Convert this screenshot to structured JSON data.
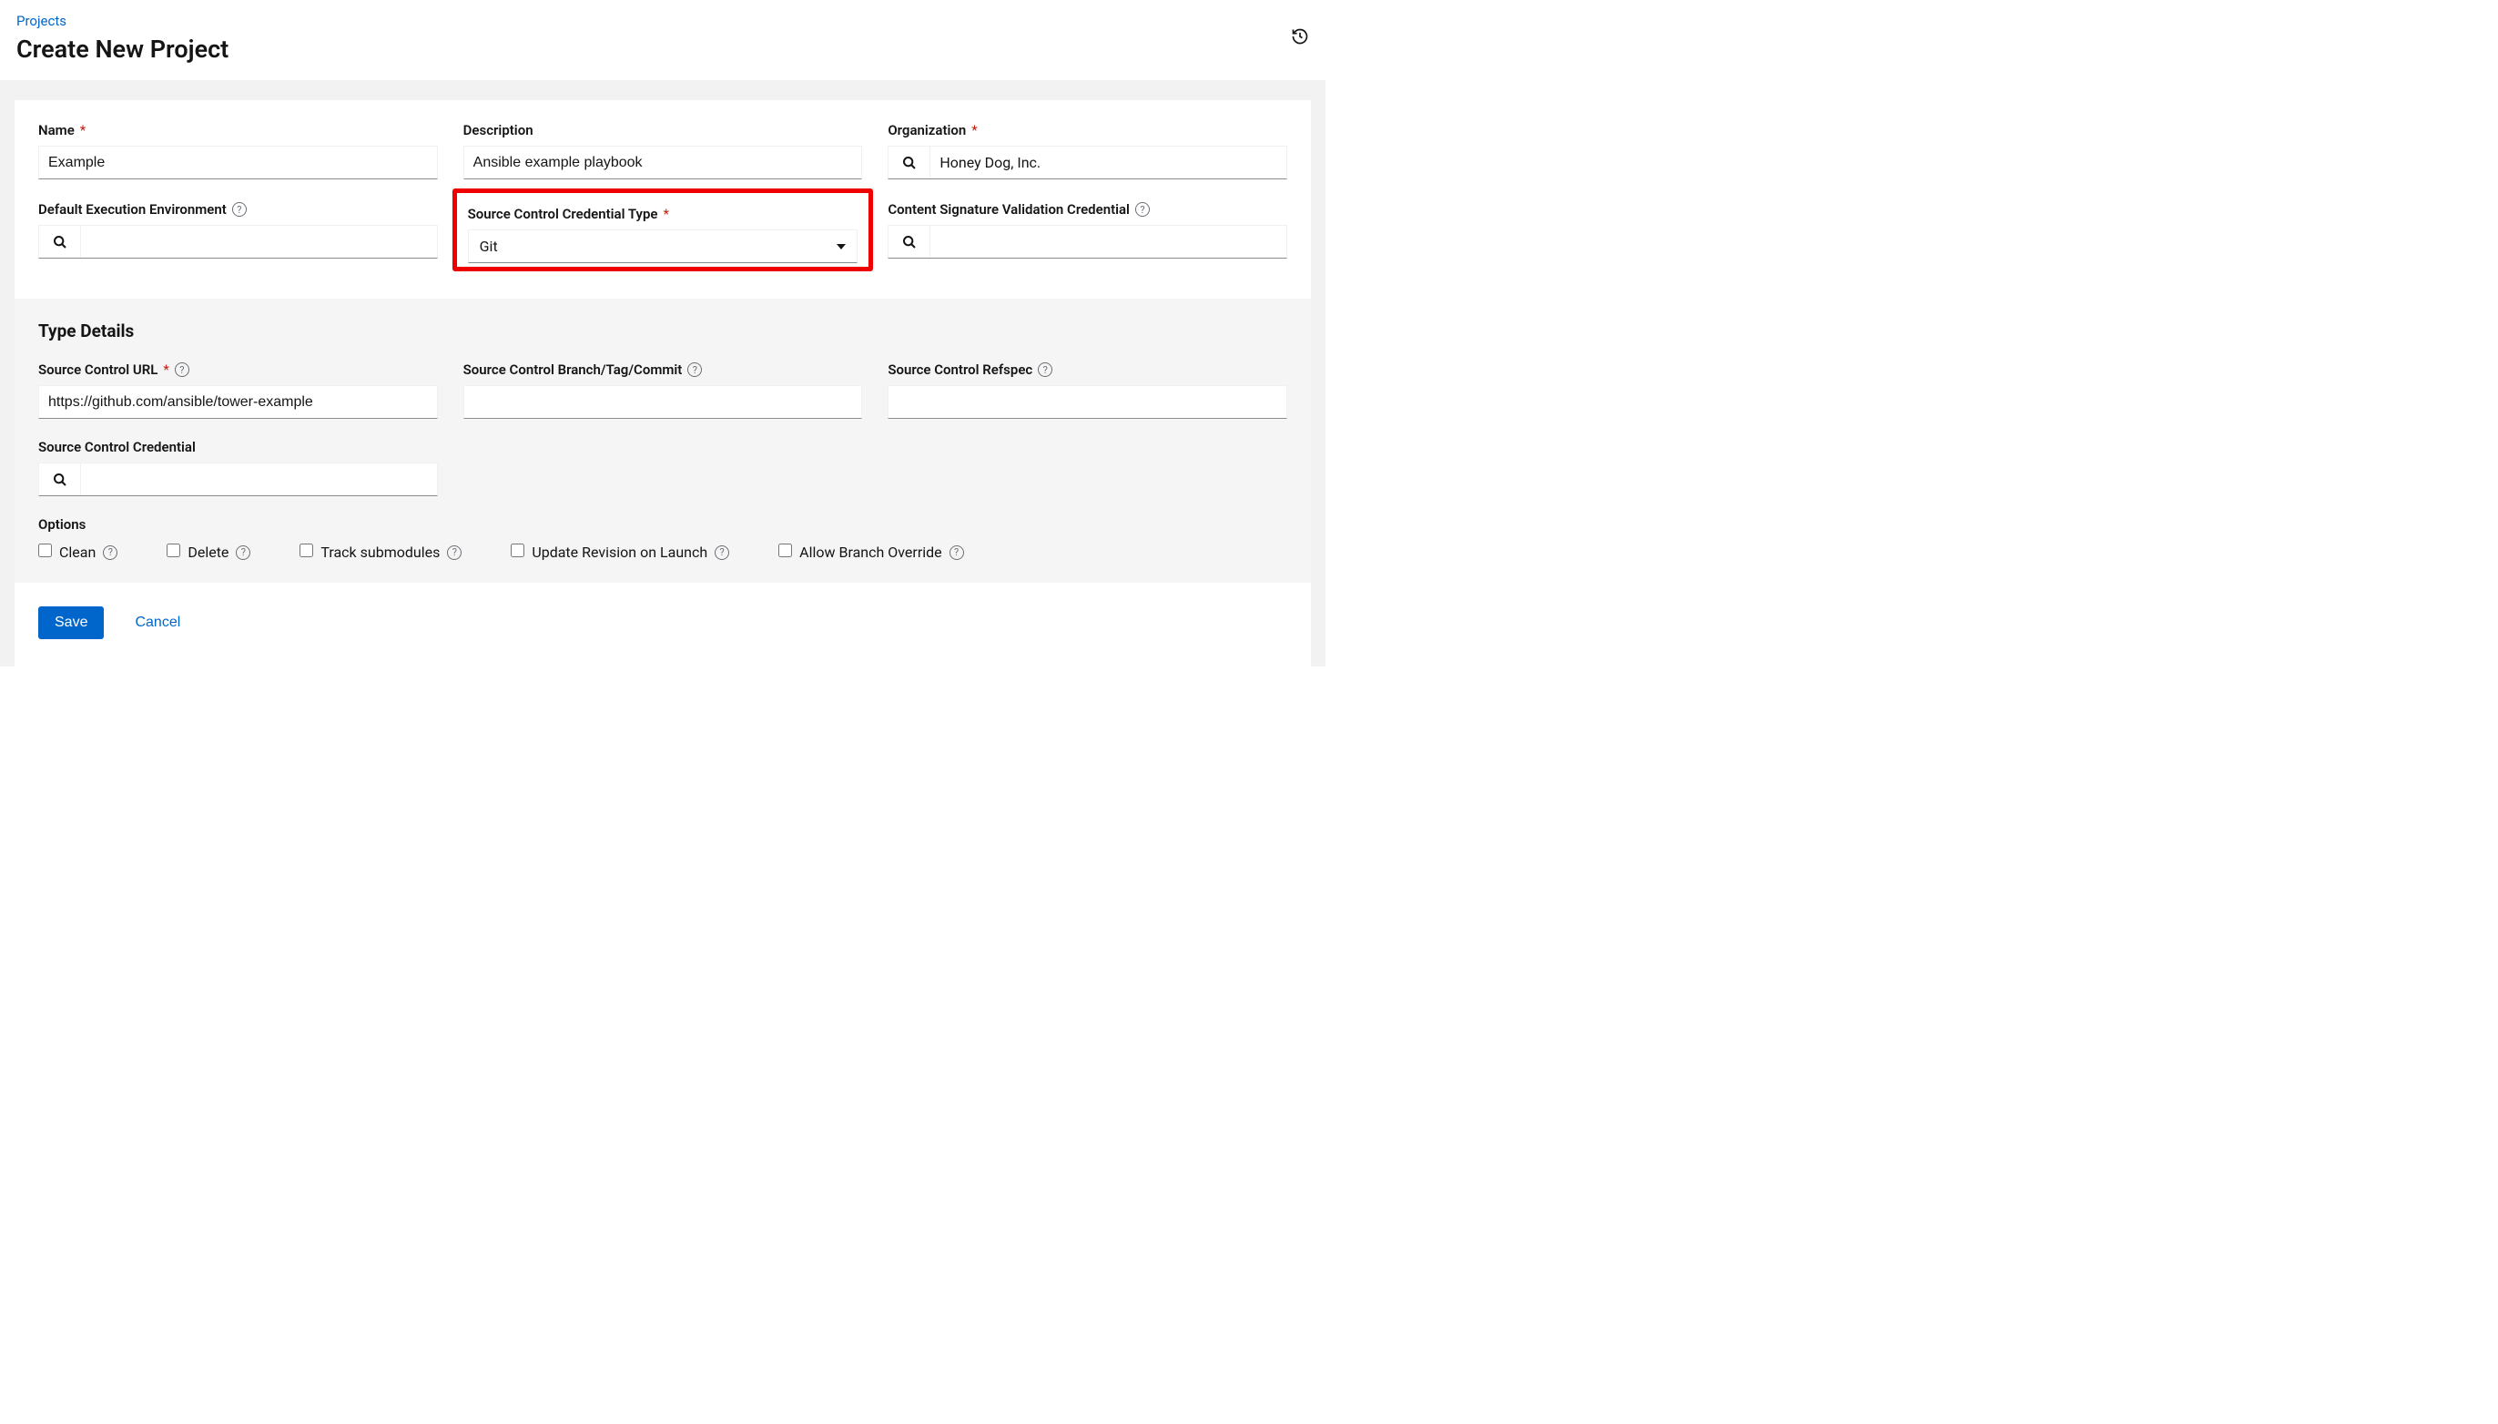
{
  "header": {
    "breadcrumb": "Projects",
    "title": "Create New Project"
  },
  "fields": {
    "name": {
      "label": "Name",
      "value": "Example"
    },
    "description": {
      "label": "Description",
      "value": "Ansible example playbook"
    },
    "organization": {
      "label": "Organization",
      "value": "Honey Dog, Inc."
    },
    "exec_env": {
      "label": "Default Execution Environment",
      "value": ""
    },
    "scc_type": {
      "label": "Source Control Credential Type",
      "value": "Git"
    },
    "content_sig": {
      "label": "Content Signature Validation Credential",
      "value": ""
    }
  },
  "type_details": {
    "title": "Type Details",
    "sc_url": {
      "label": "Source Control URL",
      "value": "https://github.com/ansible/tower-example"
    },
    "sc_branch": {
      "label": "Source Control Branch/Tag/Commit",
      "value": ""
    },
    "sc_refspec": {
      "label": "Source Control Refspec",
      "value": ""
    },
    "sc_cred": {
      "label": "Source Control Credential",
      "value": ""
    }
  },
  "options": {
    "title": "Options",
    "items": {
      "clean": "Clean",
      "delete": "Delete",
      "track": "Track submodules",
      "update": "Update Revision on Launch",
      "allow": "Allow Branch Override"
    }
  },
  "footer": {
    "save": "Save",
    "cancel": "Cancel"
  }
}
